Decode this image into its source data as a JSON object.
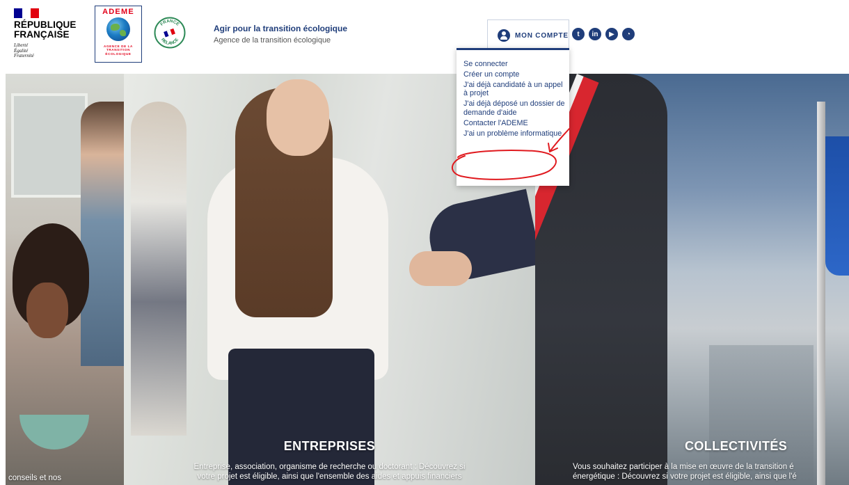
{
  "header": {
    "rf": {
      "name": "RÉPUBLIQUE\nFRANÇAISE",
      "motto": "Liberté\nÉgalité\nFraternité"
    },
    "ademe": {
      "title": "ADEME",
      "subtitle": "AGENCE DE LA\nTRANSITION\nÉCOLOGIQUE"
    },
    "relance_seal": "FRANCE RELANCE",
    "site_title": "Agir pour la transition écologique",
    "site_subtitle": "Agence de la transition écologique",
    "account": {
      "label": "MON COMPTE",
      "icon": "user-icon"
    },
    "socials": [
      {
        "icon": "twitter-icon",
        "glyph": "t"
      },
      {
        "icon": "linkedin-icon",
        "glyph": "in"
      },
      {
        "icon": "youtube-icon",
        "glyph": "▶"
      },
      {
        "icon": "rss-icon",
        "glyph": "◔"
      }
    ]
  },
  "dropdown": {
    "items": [
      {
        "label": "Se connecter"
      },
      {
        "label": "Créer un compte"
      },
      {
        "label": "J'ai déjà candidaté à un appel à projet"
      },
      {
        "label": "J'ai déjà déposé un dossier de demande d'aide"
      },
      {
        "label": "Contacter l'ADEME"
      },
      {
        "label": "J'ai un problème informatique",
        "highlighted": true
      }
    ]
  },
  "panels": {
    "left": {
      "text": "conseils et nos"
    },
    "mid": {
      "title": "ENTREPRISES",
      "text": "Entreprise, association, organisme de recherche ou doctorant : Découvrez si\nvotre projet est éligible, ainsi que l'ensemble des aides et appuis financiers"
    },
    "right": {
      "title": "COLLECTIVITÉS",
      "text": "Vous souhaitez participer à la mise en œuvre de la transition é\nénergétique : Découvrez si votre projet est éligible, ainsi que l'é"
    }
  },
  "colors": {
    "brand_blue": "#1f3d7a",
    "republique_blue": "#000091",
    "republique_red": "#e1000f",
    "ademe_red": "#e2001a",
    "annotation_red": "#e0191e"
  }
}
